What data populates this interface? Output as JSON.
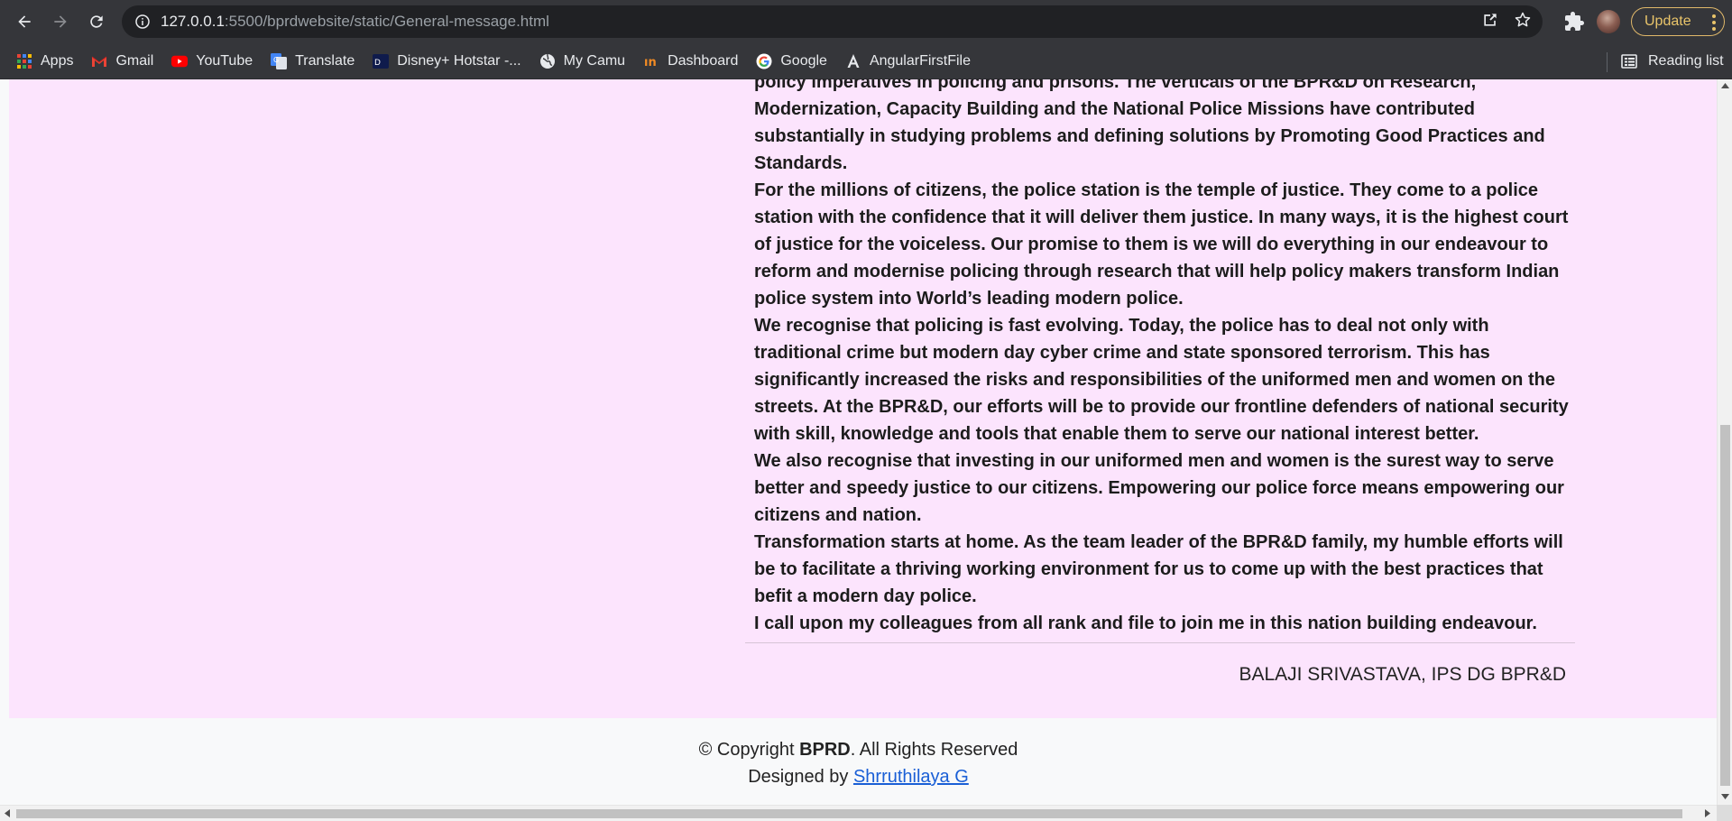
{
  "browser": {
    "url_host": "127.0.0.1",
    "url_path": ":5500/bprdwebsite/static/General-message.html",
    "update_label": "Update",
    "bookmarks": [
      {
        "label": "Apps",
        "icon": "apps-grid-icon"
      },
      {
        "label": "Gmail",
        "icon": "gmail-icon"
      },
      {
        "label": "YouTube",
        "icon": "youtube-icon"
      },
      {
        "label": "Translate",
        "icon": "translate-icon"
      },
      {
        "label": "Disney+ Hotstar -...",
        "icon": "hotstar-icon"
      },
      {
        "label": "My Camu",
        "icon": "globe-icon"
      },
      {
        "label": "Dashboard",
        "icon": "dashboard-icon"
      },
      {
        "label": "Google",
        "icon": "google-icon"
      },
      {
        "label": "AngularFirstFile",
        "icon": "angular-icon"
      }
    ],
    "reading_list_label": "Reading list"
  },
  "message": {
    "paragraphs": [
      "policy imperatives in policing and prisons. The verticals of the BPR&D on Research, Modernization, Capacity Building and the National Police Missions have contributed substantially in studying problems and defining solutions by Promoting Good Practices and Standards.",
      "For the millions of citizens, the police station is the temple of justice. They come to a police station with the confidence that it will deliver them justice. In many ways, it is the highest court of justice for the voiceless. Our promise to them is we will do everything in our endeavour to reform and modernise policing through research that will help policy makers transform Indian police system into World’s leading modern police.",
      "We recognise that policing is fast evolving. Today, the police has to deal not only with traditional crime but modern day cyber crime and state sponsored terrorism. This has significantly increased the risks and responsibilities of the uniformed men and women on the streets. At the BPR&D, our efforts will be to provide our frontline defenders of national security with skill, knowledge and tools that enable them to serve our national interest better.",
      "We also recognise that investing in our uniformed men and women is the surest way to serve better and speedy justice to our citizens. Empowering our police force means empowering our citizens and nation.",
      "Transformation starts at home. As the team leader of the BPR&D family, my humble efforts will be to facilitate a thriving working environment for us to come up with the best practices that befit a modern day police.",
      "I call upon my colleagues from all rank and file to join me in this nation building endeavour."
    ],
    "signature": "BALAJI SRIVASTAVA, IPS DG BPR&D"
  },
  "footer": {
    "copyright_prefix": "© Copyright ",
    "copyright_brand": "BPRD",
    "copyright_suffix": ". All Rights Reserved",
    "designed_prefix": "Designed by ",
    "designer_name": "Shrruthilaya G"
  },
  "colors": {
    "content_bg": "#fce4fd",
    "footer_bg": "#f8f9fa",
    "link": "#1a5fd6",
    "chrome_bg": "#35363a"
  }
}
